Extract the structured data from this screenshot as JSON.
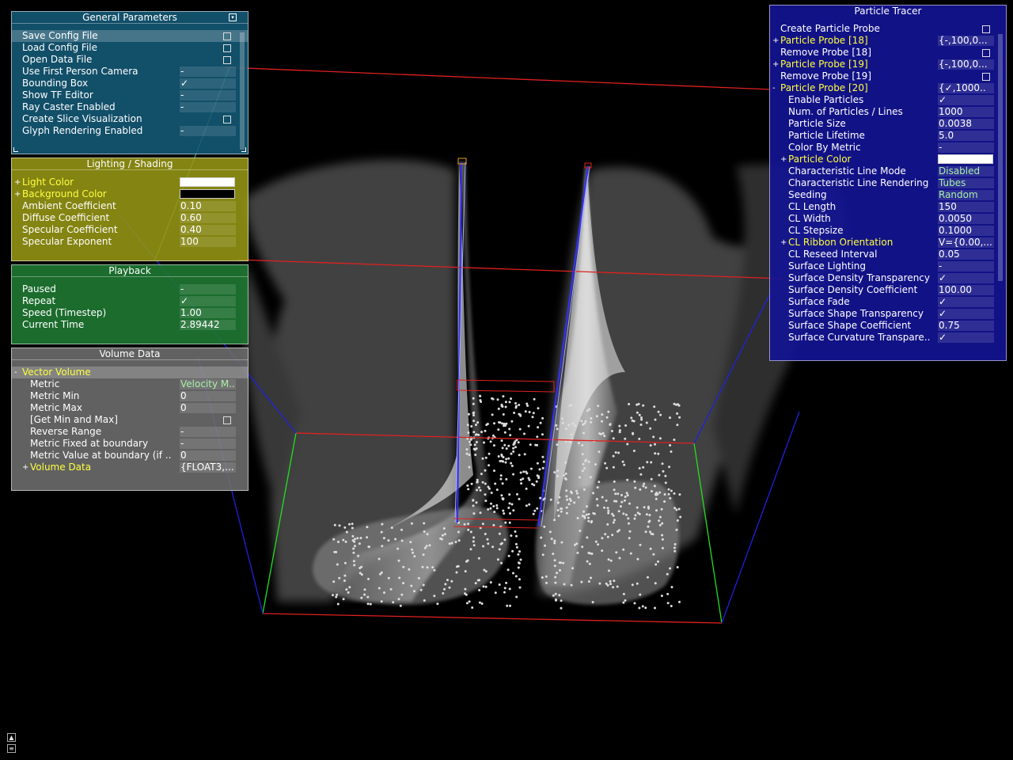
{
  "general": {
    "title": "General Parameters",
    "items": [
      {
        "label": "Save Config File",
        "value": "",
        "kind": "button"
      },
      {
        "label": "Load Config File",
        "value": "",
        "kind": "button"
      },
      {
        "label": "Open Data File",
        "value": "",
        "kind": "button"
      },
      {
        "label": "Use First Person Camera",
        "value": "-",
        "kind": "bool"
      },
      {
        "label": "Bounding Box",
        "value": "✓",
        "kind": "bool"
      },
      {
        "label": "Show TF Editor",
        "value": "-",
        "kind": "bool"
      },
      {
        "label": "Ray Caster Enabled",
        "value": "-",
        "kind": "bool"
      },
      {
        "label": "Create Slice Visualization",
        "value": "",
        "kind": "button"
      },
      {
        "label": "Glyph Rendering Enabled",
        "value": "-",
        "kind": "bool"
      }
    ]
  },
  "lighting": {
    "title": "Lighting / Shading",
    "light_color_label": "Light Color",
    "background_color_label": "Background Color",
    "light_color": "#ffffff",
    "background_color": "#000000",
    "items": [
      {
        "label": "Ambient Coefficient",
        "value": "0.10"
      },
      {
        "label": "Diffuse Coefficient",
        "value": "0.60"
      },
      {
        "label": "Specular Coefficient",
        "value": "0.40"
      },
      {
        "label": "Specular Exponent",
        "value": "100"
      }
    ]
  },
  "playback": {
    "title": "Playback",
    "items": [
      {
        "label": "Paused",
        "value": "-"
      },
      {
        "label": "Repeat",
        "value": "✓"
      },
      {
        "label": "Speed (Timestep)",
        "value": "1.00"
      },
      {
        "label": "Current Time",
        "value": "2.89442"
      }
    ]
  },
  "volume": {
    "title": "Volume Data",
    "group_label": "Vector Volume",
    "items": [
      {
        "label": "Metric",
        "value": "Velocity M.."
      },
      {
        "label": "Metric Min",
        "value": "0"
      },
      {
        "label": "Metric Max",
        "value": "0"
      },
      {
        "label": "[Get Min and Max]",
        "value": ""
      },
      {
        "label": "Reverse Range",
        "value": "-"
      },
      {
        "label": "Metric Fixed at boundary",
        "value": "-"
      },
      {
        "label": "Metric Value at boundary (if ..",
        "value": "0"
      }
    ],
    "sub_label": "Volume Data",
    "sub_value": "{FLOAT3,..."
  },
  "tracer": {
    "title": "Particle Tracer",
    "create_label": "Create Particle Probe",
    "probes": [
      {
        "label": "Particle Probe [18]",
        "value": "{-,100,0..."
      },
      {
        "label": "Remove Probe [18]",
        "value": ""
      },
      {
        "label": "Particle Probe [19]",
        "value": "{-,100,0..."
      },
      {
        "label": "Remove Probe [19]",
        "value": ""
      },
      {
        "label": "Particle Probe [20]",
        "value": "{✓,1000.."
      }
    ],
    "items": [
      {
        "label": "Enable Particles",
        "value": "✓"
      },
      {
        "label": "Num. of Particles / Lines",
        "value": "1000"
      },
      {
        "label": "Particle Size",
        "value": "0.0038"
      },
      {
        "label": "Particle Lifetime",
        "value": "5.0"
      },
      {
        "label": "Color By Metric",
        "value": "-"
      },
      {
        "label": "Particle Color",
        "value": ""
      },
      {
        "label": "Characteristic Line Mode",
        "value": "Disabled"
      },
      {
        "label": "Characteristic Line Rendering",
        "value": "Tubes"
      },
      {
        "label": "Seeding",
        "value": "Random"
      },
      {
        "label": "CL Length",
        "value": "150"
      },
      {
        "label": "CL Width",
        "value": "0.0050"
      },
      {
        "label": "CL Stepsize",
        "value": "0.1000"
      },
      {
        "label": "CL Ribbon Orientation",
        "value": "V={0.00,..."
      },
      {
        "label": "CL Reseed Interval",
        "value": "0.05"
      },
      {
        "label": "Surface Lighting",
        "value": "-"
      },
      {
        "label": "Surface Density Transparency",
        "value": "✓"
      },
      {
        "label": "Surface Density Coefficient",
        "value": "100.00"
      },
      {
        "label": "Surface Fade",
        "value": "✓"
      },
      {
        "label": "Surface Shape Transparency",
        "value": "✓"
      },
      {
        "label": "Surface Shape Coefficient",
        "value": "0.75"
      },
      {
        "label": "Surface Curvature Transpare..",
        "value": "✓"
      }
    ]
  },
  "icons": [
    "collapse-icon",
    "resize-icon",
    "expand-up-icon",
    "expand-bottom-icon"
  ]
}
